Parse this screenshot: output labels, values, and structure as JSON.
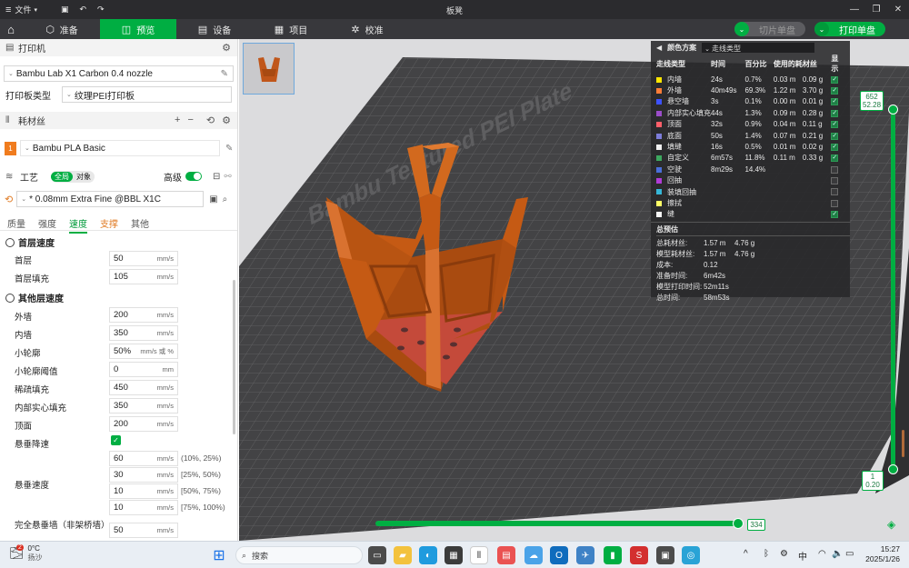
{
  "titlebar": {
    "menu_label": "文件",
    "window_title": "板凳"
  },
  "tabs": [
    {
      "label": "准备",
      "icon": "cube-icon"
    },
    {
      "label": "预览",
      "icon": "preview-icon"
    },
    {
      "label": "设备",
      "icon": "device-icon"
    },
    {
      "label": "项目",
      "icon": "project-icon"
    },
    {
      "label": "校准",
      "icon": "calibrate-icon"
    }
  ],
  "actions": {
    "slice_plate": "切片单盘",
    "print_plate": "打印单盘"
  },
  "printer": {
    "section_title": "打印机",
    "name": "Bambu Lab X1 Carbon 0.4 nozzle",
    "plate_type_label": "打印板类型",
    "plate_type": "纹理PEI打印板"
  },
  "filament": {
    "section_title": "耗材丝",
    "index": "1",
    "name": "Bambu PLA Basic"
  },
  "process": {
    "section_title": "工艺",
    "scope_global": "全局",
    "scope_object": "对象",
    "advanced_label": "高级",
    "preset": "* 0.08mm Extra Fine @BBL X1C",
    "subtabs": [
      "质量",
      "强度",
      "速度",
      "支撑",
      "其他"
    ]
  },
  "speed": {
    "first_layer_group": "首层速度",
    "first_layer": {
      "label": "首层",
      "value": "50",
      "unit": "mm/s"
    },
    "first_layer_infill": {
      "label": "首层填充",
      "value": "105",
      "unit": "mm/s"
    },
    "other_group": "其他层速度",
    "outer_wall": {
      "label": "外墙",
      "value": "200",
      "unit": "mm/s"
    },
    "inner_wall": {
      "label": "内墙",
      "value": "350",
      "unit": "mm/s"
    },
    "small_perimeter": {
      "label": "小轮廓",
      "value": "50%",
      "unit": "mm/s 或 %"
    },
    "small_perimeter_threshold": {
      "label": "小轮廓阈值",
      "value": "0",
      "unit": "mm"
    },
    "sparse_infill": {
      "label": "稀疏填充",
      "value": "450",
      "unit": "mm/s"
    },
    "internal_solid_infill": {
      "label": "内部实心填充",
      "value": "350",
      "unit": "mm/s"
    },
    "top_surface": {
      "label": "顶面",
      "value": "200",
      "unit": "mm/s"
    },
    "overhang_slowdown_label": "悬垂降速",
    "overhang_speed_label": "悬垂速度",
    "overhang_speeds": [
      {
        "value": "60",
        "unit": "mm/s",
        "range": "(10%, 25%)"
      },
      {
        "value": "30",
        "unit": "mm/s",
        "range": "[25%, 50%)"
      },
      {
        "value": "10",
        "unit": "mm/s",
        "range": "[50%, 75%)"
      },
      {
        "value": "10",
        "unit": "mm/s",
        "range": "[75%, 100%)"
      }
    ],
    "bridge": {
      "label": "完全悬垂墙（非架桥墙）",
      "value": "50",
      "unit": "mm/s"
    }
  },
  "legend": {
    "scheme_label": "颜色方案",
    "scheme_value": "走线类型",
    "headers": [
      "走线类型",
      "时间",
      "百分比",
      "使用的耗材丝",
      "显示"
    ],
    "rows": [
      {
        "name": "内墙",
        "color": "#ffe600",
        "time": "24s",
        "pct": "0.7%",
        "len": "0.03 m",
        "wt": "0.09 g",
        "show": true
      },
      {
        "name": "外墙",
        "color": "#ff7d38",
        "time": "40m49s",
        "pct": "69.3%",
        "len": "1.22 m",
        "wt": "3.70 g",
        "show": true
      },
      {
        "name": "悬空墙",
        "color": "#3d52ff",
        "time": "3s",
        "pct": "0.1%",
        "len": "0.00 m",
        "wt": "0.01 g",
        "show": true
      },
      {
        "name": "内部实心填充",
        "color": "#9b4dc9",
        "time": "44s",
        "pct": "1.3%",
        "len": "0.09 m",
        "wt": "0.28 g",
        "show": true
      },
      {
        "name": "顶面",
        "color": "#ff5f6a",
        "time": "32s",
        "pct": "0.9%",
        "len": "0.04 m",
        "wt": "0.11 g",
        "show": true
      },
      {
        "name": "底面",
        "color": "#7d7dd9",
        "time": "50s",
        "pct": "1.4%",
        "len": "0.07 m",
        "wt": "0.21 g",
        "show": true
      },
      {
        "name": "填缝",
        "color": "#f0f0f0",
        "time": "16s",
        "pct": "0.5%",
        "len": "0.01 m",
        "wt": "0.02 g",
        "show": true
      },
      {
        "name": "自定义",
        "color": "#3da85f",
        "time": "6m57s",
        "pct": "11.8%",
        "len": "0.11 m",
        "wt": "0.33 g",
        "show": true
      },
      {
        "name": "空驶",
        "color": "#4a6fd9",
        "time": "8m29s",
        "pct": "14.4%",
        "len": "",
        "wt": "",
        "show": false
      },
      {
        "name": "回抽",
        "color": "#b03cd6",
        "time": "",
        "pct": "",
        "len": "",
        "wt": "",
        "show": false
      },
      {
        "name": "装填回抽",
        "color": "#36b7d8",
        "time": "",
        "pct": "",
        "len": "",
        "wt": "",
        "show": false
      },
      {
        "name": "擦拭",
        "color": "#ffff66",
        "time": "",
        "pct": "",
        "len": "",
        "wt": "",
        "show": false
      },
      {
        "name": "缝",
        "color": "#f5f5f5",
        "time": "",
        "pct": "",
        "len": "",
        "wt": "",
        "show": true
      }
    ],
    "summary_title": "总预估",
    "summary": [
      {
        "k": "总耗材丝:",
        "v1": "1.57 m",
        "v2": "4.76 g"
      },
      {
        "k": "模型耗材丝:",
        "v1": "1.57 m",
        "v2": "4.76 g"
      },
      {
        "k": "成本:",
        "v1": "0.12",
        "v2": ""
      },
      {
        "k": "准备时间:",
        "v1": "6m42s",
        "v2": ""
      },
      {
        "k": "模型打印时间:",
        "v1": "52m11s",
        "v2": ""
      },
      {
        "k": "总时间:",
        "v1": "58m53s",
        "v2": ""
      }
    ]
  },
  "plate_label": "Bambu Textured PEI Plate",
  "layer_slider": {
    "top_layer": "652",
    "top_height": "52.28",
    "bottom_layer": "1",
    "bottom_height": "0.20"
  },
  "move_slider": {
    "value": "334",
    "position": 1.0
  },
  "taskbar": {
    "weather_temp": "0°C",
    "weather_desc": "扬沙",
    "weather_badge": "2",
    "search_placeholder": "搜索",
    "ime": "中",
    "time": "15:27",
    "date": "2025/1/26"
  },
  "colors": {
    "accent": "#00ae42",
    "model": "#d2691e"
  }
}
